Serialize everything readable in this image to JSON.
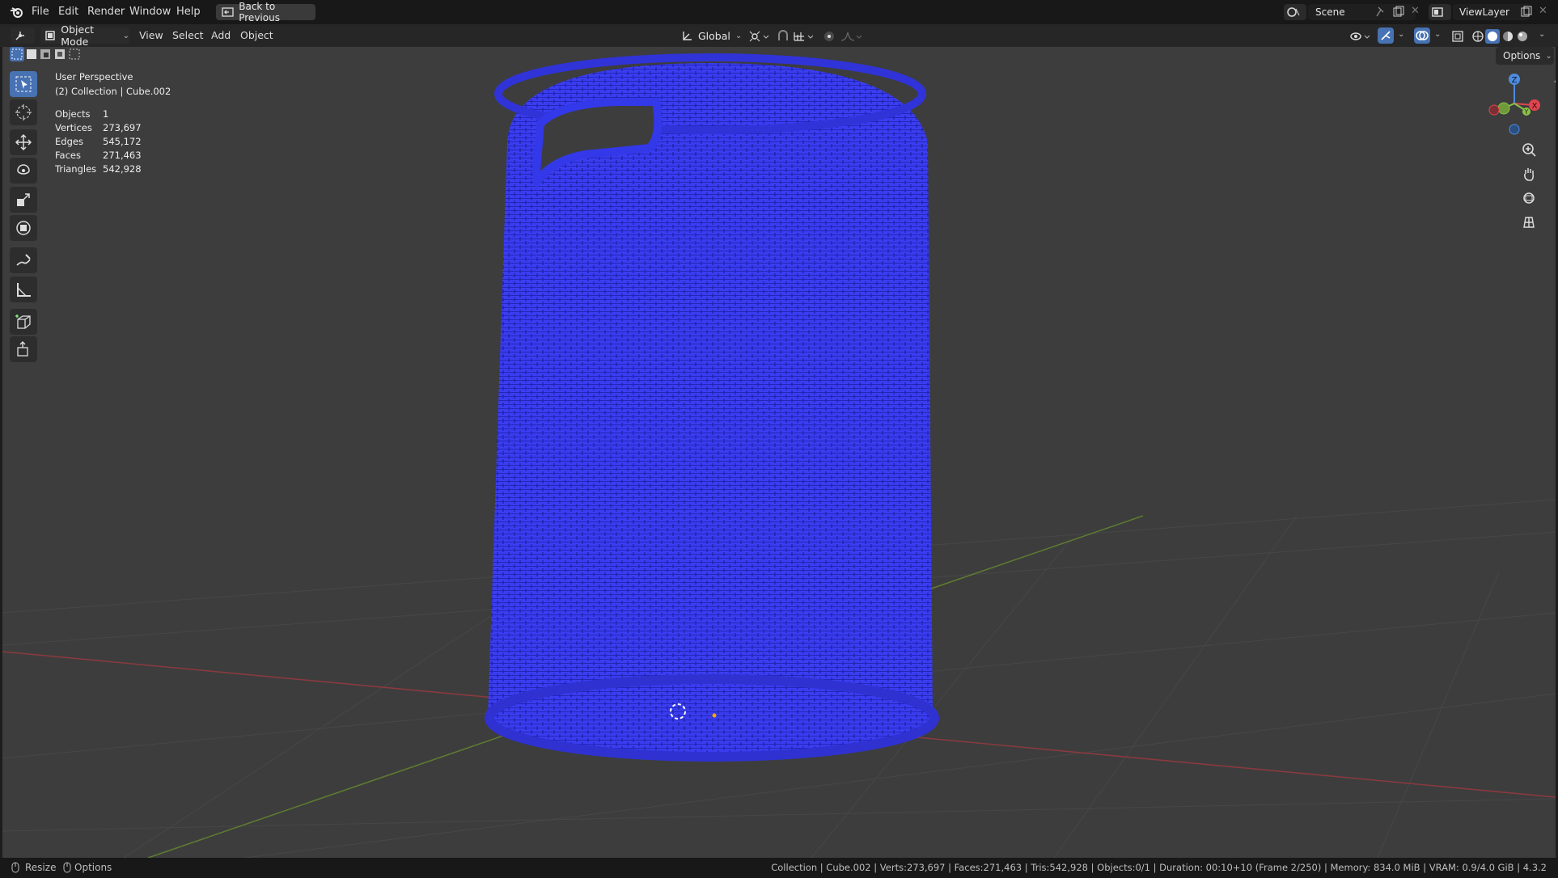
{
  "topbar": {
    "menus": [
      "File",
      "Edit",
      "Render",
      "Window",
      "Help"
    ],
    "back_button": "Back to Previous",
    "scene": "Scene",
    "view_layer": "ViewLayer"
  },
  "header": {
    "mode": "Object Mode",
    "menus": [
      "View",
      "Select",
      "Add",
      "Object"
    ],
    "transform_orientation": "Global",
    "options": "Options"
  },
  "overlay": {
    "perspective": "User Perspective",
    "collection": "(2) Collection | Cube.002",
    "stats": [
      {
        "label": "Objects",
        "value": "1"
      },
      {
        "label": "Vertices",
        "value": "273,697"
      },
      {
        "label": "Edges",
        "value": "545,172"
      },
      {
        "label": "Faces",
        "value": "271,463"
      },
      {
        "label": "Triangles",
        "value": "542,928"
      }
    ]
  },
  "gizmo": {
    "z": "Z",
    "x": "X",
    "y": "Y"
  },
  "statusbar": {
    "resize": "Resize",
    "options": "Options",
    "info": "Collection | Cube.002 | Verts:273,697 | Faces:271,463 | Tris:542,928 | Objects:0/1 | Duration: 00:10+10 (Frame 2/250) | Memory: 834.0 MiB | VRAM: 0.9/4.0 GiB | 4.3.2"
  },
  "colors": {
    "mesh": "#3a3df0",
    "active_tool": "#4772b3",
    "x_axis": "#e0454f",
    "y_axis": "#8bc34a",
    "z_axis": "#4d8ce0"
  },
  "icons": [
    "blender-logo-icon",
    "back-icon",
    "editor-type-icon",
    "object-mode-icon",
    "select-box-icon",
    "cursor-icon",
    "move-icon",
    "rotate-icon",
    "scale-icon",
    "transform-icon",
    "annotate-icon",
    "measure-icon",
    "add-cube-icon",
    "extrude-icon",
    "zoom-icon",
    "hand-icon",
    "camera-icon",
    "grid-icon"
  ]
}
